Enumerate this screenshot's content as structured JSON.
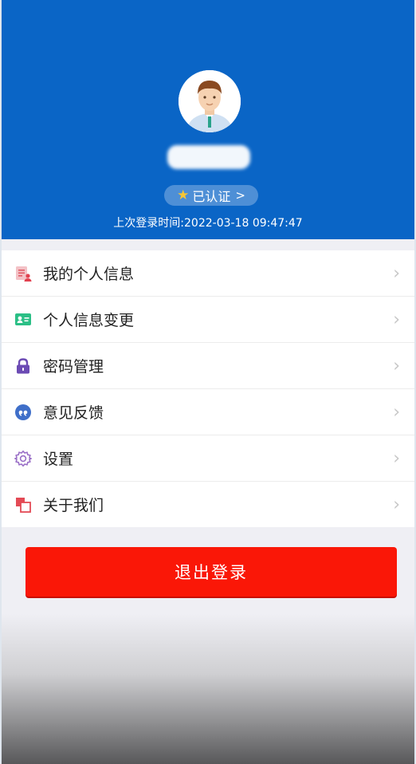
{
  "profile": {
    "verified_label": "已认证",
    "last_login_text": "上次登录时间:2022-03-18 09:47:47"
  },
  "menu": {
    "items": [
      {
        "label": "我的个人信息",
        "icon": "profile-card-icon"
      },
      {
        "label": "个人信息变更",
        "icon": "id-card-icon"
      },
      {
        "label": "密码管理",
        "icon": "lock-icon"
      },
      {
        "label": "意见反馈",
        "icon": "feedback-quote-icon"
      },
      {
        "label": "设置",
        "icon": "gear-icon"
      },
      {
        "label": "关于我们",
        "icon": "about-squares-icon"
      }
    ]
  },
  "logout": {
    "label": "退出登录"
  },
  "colors": {
    "header_bg": "#0a65c6",
    "logout_bg": "#fa1707",
    "page_bg": "#efeff4"
  }
}
